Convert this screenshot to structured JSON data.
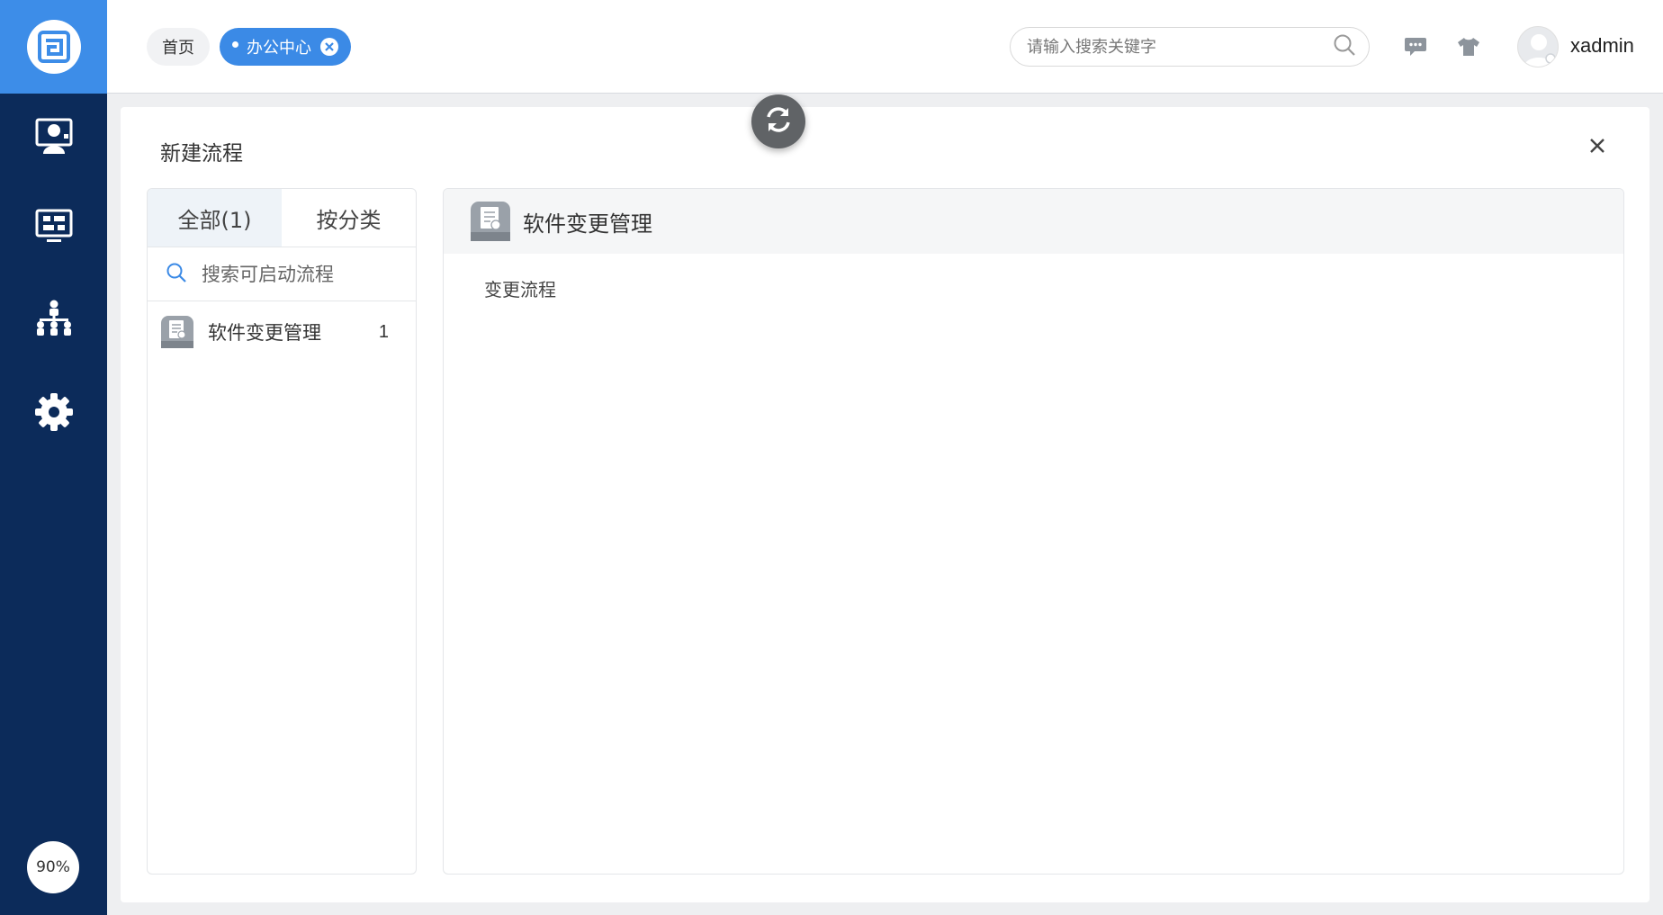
{
  "app": {
    "zoom": "90%"
  },
  "colors": {
    "sidebar": "#0c2b5a",
    "accent": "#3d8de8"
  },
  "sidebar": {
    "items": [
      {
        "icon": "user-monitor-icon"
      },
      {
        "icon": "dashboard-icon"
      },
      {
        "icon": "org-chart-icon"
      },
      {
        "icon": "gear-icon"
      }
    ]
  },
  "header": {
    "tabs": [
      {
        "label": "首页",
        "active": false
      },
      {
        "label": "办公中心",
        "active": true
      }
    ],
    "search": {
      "placeholder": "请输入搜索关键字",
      "value": ""
    },
    "username": "xadmin"
  },
  "dialog": {
    "title": "新建流程",
    "tabs": [
      {
        "label": "全部(1)",
        "active": true
      },
      {
        "label": "按分类",
        "active": false
      }
    ],
    "search_placeholder": "搜索可启动流程",
    "process_list": [
      {
        "name": "软件变更管理",
        "count": "1"
      }
    ],
    "detail": {
      "title": "软件变更管理",
      "flows": [
        "变更流程"
      ]
    }
  }
}
